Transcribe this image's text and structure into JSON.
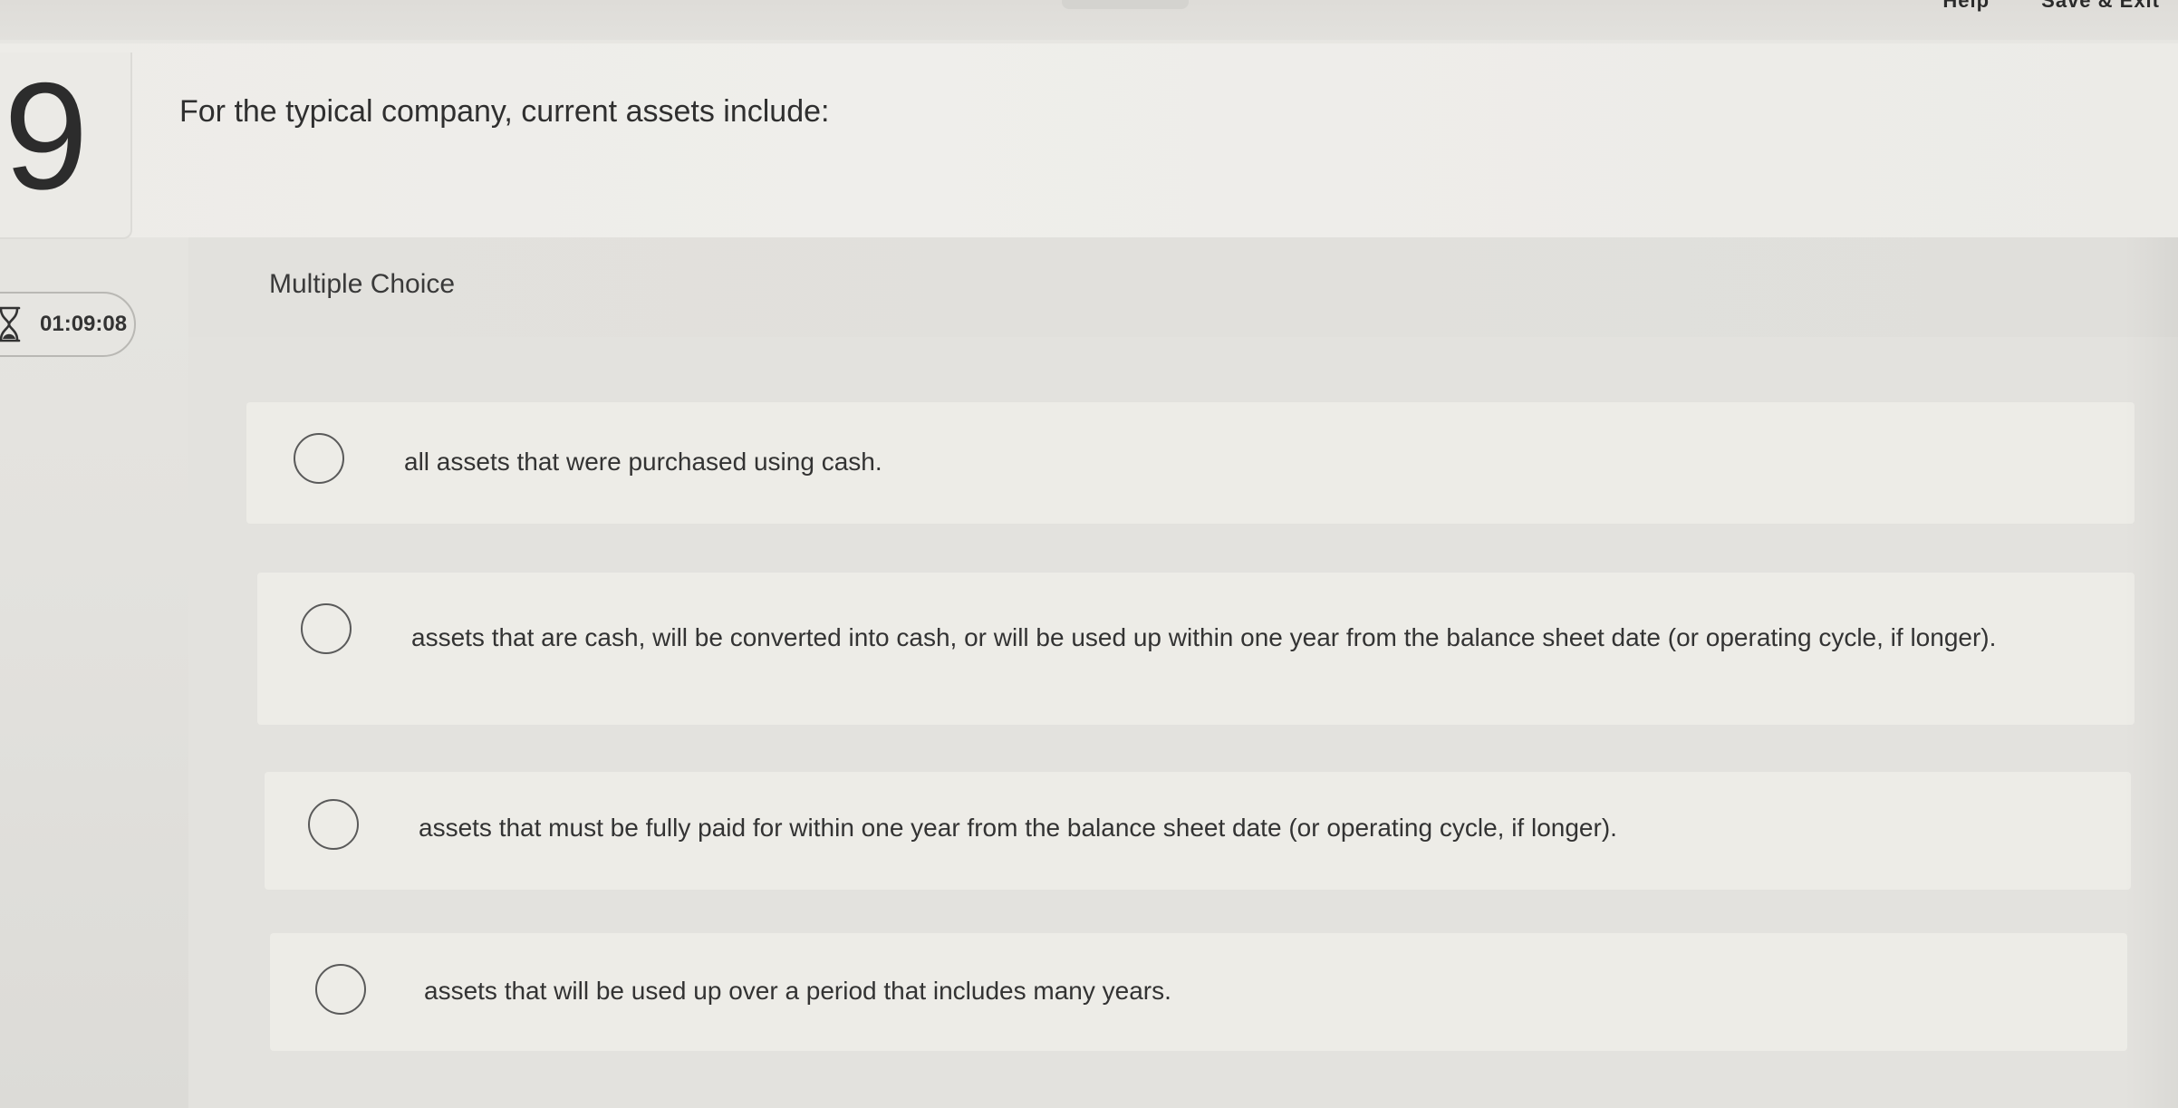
{
  "top_actions": [
    "Help",
    "Save & Exit"
  ],
  "question": {
    "number": "9",
    "prompt": "For the typical company, current assets include:"
  },
  "timer": {
    "icon": "hourglass-icon",
    "value": "01:09:08"
  },
  "question_type": "Multiple Choice",
  "options": [
    {
      "text": "all assets that were purchased using cash."
    },
    {
      "text": "assets that are cash, will be converted into cash, or will be used up within one year from the balance sheet date (or operating cycle, if longer)."
    },
    {
      "text": "assets that must be fully paid for within one year from the balance sheet date (or operating cycle, if longer)."
    },
    {
      "text": "assets that will be used up over a period that includes many years."
    }
  ]
}
